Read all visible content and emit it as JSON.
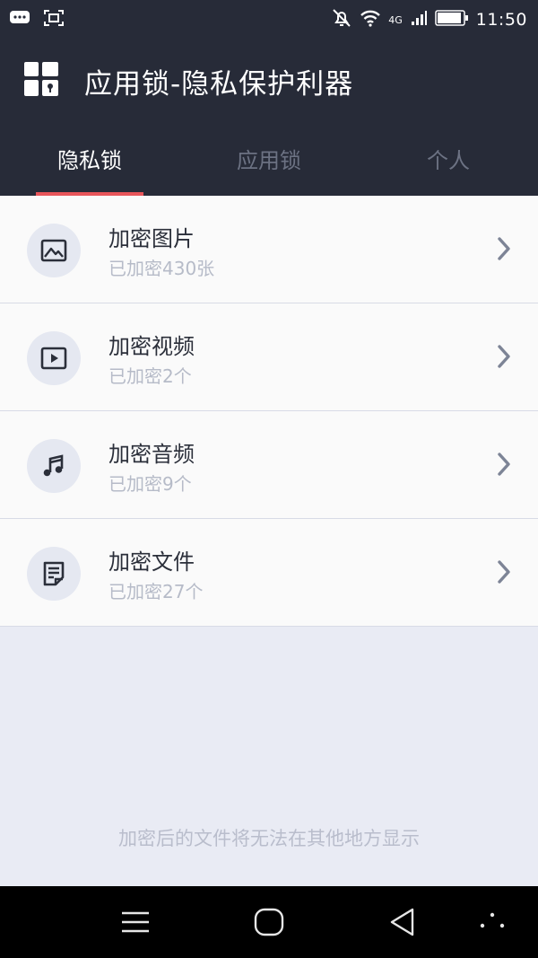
{
  "status_bar": {
    "time": "11:50",
    "network": "4G",
    "icons": [
      "chat-icon",
      "screenshot-icon",
      "bell-off-icon",
      "wifi-icon",
      "signal-icon",
      "battery-icon"
    ]
  },
  "header": {
    "title": "应用锁-隐私保护利器",
    "logo_icon": "dashboard-lock-icon"
  },
  "tabs": [
    {
      "label": "隐私锁",
      "active": true
    },
    {
      "label": "应用锁",
      "active": false
    },
    {
      "label": "个人",
      "active": false
    }
  ],
  "items": [
    {
      "title": "加密图片",
      "subtitle": "已加密430张",
      "icon": "image-icon"
    },
    {
      "title": "加密视频",
      "subtitle": "已加密2个",
      "icon": "video-icon"
    },
    {
      "title": "加密音频",
      "subtitle": "已加密9个",
      "icon": "music-icon"
    },
    {
      "title": "加密文件",
      "subtitle": "已加密27个",
      "icon": "file-icon"
    }
  ],
  "footer_note": "加密后的文件将无法在其他地方显示",
  "nav_bar": {
    "buttons": [
      "menu-icon",
      "home-icon",
      "back-icon",
      "more-icon"
    ]
  },
  "colors": {
    "header_bg": "#272b38",
    "tab_indicator": "#e8555a",
    "page_bg": "#e9ebf4",
    "subtitle": "#b6bbc8"
  }
}
